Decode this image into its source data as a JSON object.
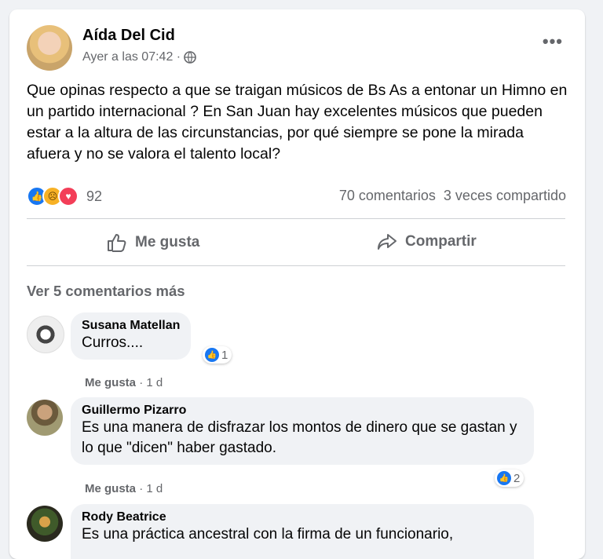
{
  "post": {
    "author": "Aída Del Cid",
    "time": "Ayer a las 07:42 ·",
    "text": "Que opinas respecto a que se traigan músicos de Bs As a entonar un Himno en un partido internacional ? En San Juan hay excelentes músicos que pueden estar a la altura de las circunstancias, por qué siempre se pone la mirada afuera y no se valora el talento local?",
    "reaction_count": "92",
    "comments_count": "70 comentarios",
    "shares_count": "3 veces compartido"
  },
  "actions": {
    "like_label": "Me gusta",
    "share_label": "Compartir"
  },
  "see_more_comments": "Ver 5 comentarios más",
  "comments": [
    {
      "name": "Susana Matellan",
      "text": "Curros....",
      "reactions": "1",
      "like": "Me gusta",
      "age": "· 1 d"
    },
    {
      "name": "Guillermo Pizarro",
      "text": "Es una manera de disfrazar los montos de dinero que se gastan y lo que \"dicen\" haber gastado.",
      "reactions": "2",
      "like": "Me gusta",
      "age": "· 1 d"
    },
    {
      "name": "Rody Beatrice",
      "text": "Es una práctica ancestral con la firma de un funcionario,"
    }
  ],
  "colors": {
    "accent": "#1877f2",
    "muted": "#65676b",
    "bubble": "#f0f2f5"
  },
  "icons": [
    "globe-icon",
    "more-icon",
    "like-icon",
    "share-icon",
    "like-reaction-icon",
    "sad-reaction-icon",
    "love-reaction-icon"
  ]
}
